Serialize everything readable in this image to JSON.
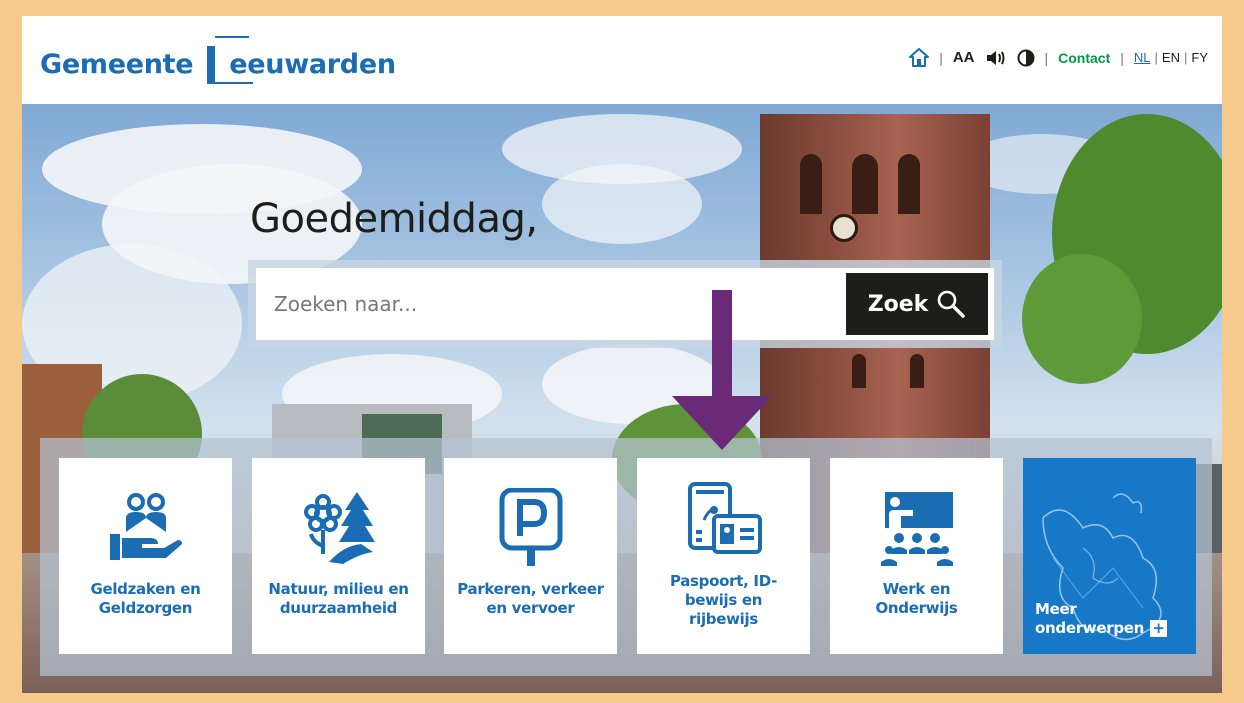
{
  "header": {
    "logo_text_part1": "Gemeente",
    "logo_text_part2": "eeuwarden",
    "home_icon": "home-icon",
    "text_size_label": "AA",
    "speaker_icon": "speaker-icon",
    "contrast_icon": "contrast-icon",
    "contact_label": "Contact",
    "languages": [
      {
        "code": "NL",
        "active": true
      },
      {
        "code": "EN",
        "active": false
      },
      {
        "code": "FY",
        "active": false
      }
    ],
    "separator": "|"
  },
  "hero": {
    "greeting": "Goedemiddag,",
    "search": {
      "placeholder": "Zoeken naar...",
      "value": "",
      "button_label": "Zoek",
      "button_icon": "search-icon"
    }
  },
  "tiles": [
    {
      "label_line1": "Geldzaken en",
      "label_line2": "Geldzorgen",
      "label_line3": "",
      "icon": "money-care-icon"
    },
    {
      "label_line1": "Natuur, milieu en",
      "label_line2": "duurzaamheid",
      "label_line3": "",
      "icon": "nature-icon"
    },
    {
      "label_line1": "Parkeren, verkeer",
      "label_line2": "en vervoer",
      "label_line3": "",
      "icon": "parking-icon"
    },
    {
      "label_line1": "Paspoort, ID-",
      "label_line2": "bewijs en",
      "label_line3": "rijbewijs",
      "icon": "id-card-icon"
    },
    {
      "label_line1": "Werk en",
      "label_line2": "Onderwijs",
      "label_line3": "",
      "icon": "classroom-icon"
    }
  ],
  "more_tile": {
    "label_line1": "Meer",
    "label_line2": "onderwerpen",
    "plus": "+"
  },
  "colors": {
    "brand_blue": "#1a6db3",
    "contact_green": "#009a44",
    "annotation_arrow": "#6b2a78",
    "frame_border": "#f6c98d"
  }
}
